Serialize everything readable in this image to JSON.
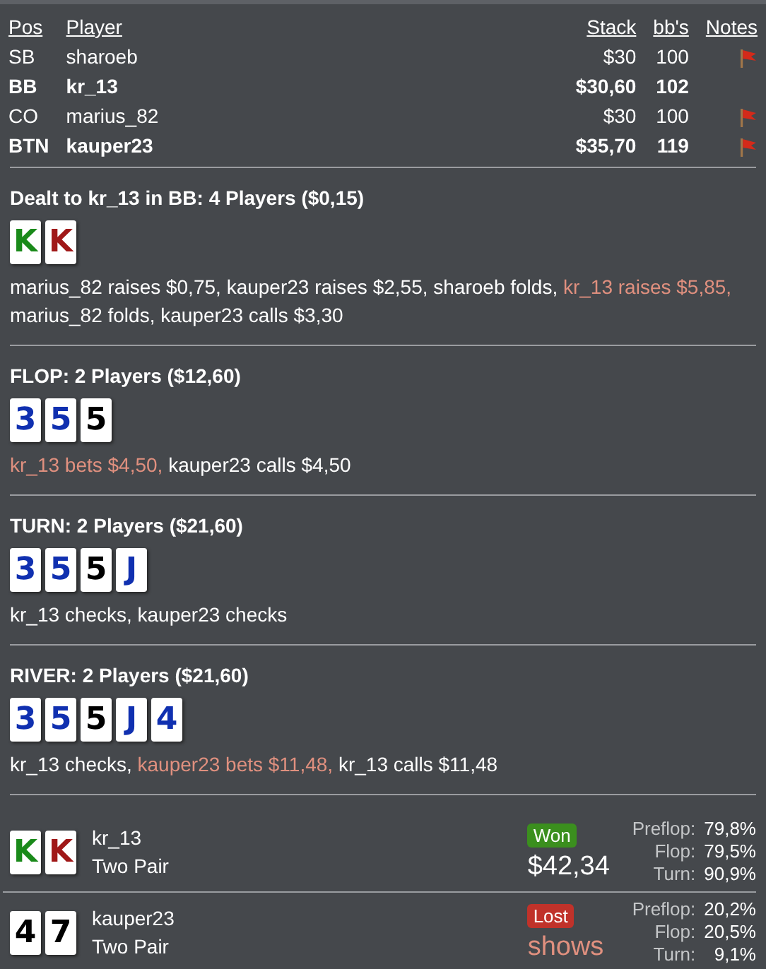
{
  "players": {
    "columns": [
      "Pos",
      "Player",
      "Stack",
      "bb's",
      "Notes"
    ],
    "rows": [
      {
        "pos": "SB",
        "name": "sharoeb",
        "stack": "$30",
        "bbs": "100",
        "bold": false,
        "note": true
      },
      {
        "pos": "BB",
        "name": "kr_13",
        "stack": "$30,60",
        "bbs": "102",
        "bold": true,
        "note": false
      },
      {
        "pos": "CO",
        "name": "marius_82",
        "stack": "$30",
        "bbs": "100",
        "bold": false,
        "note": true
      },
      {
        "pos": "BTN",
        "name": "kauper23",
        "stack": "$35,70",
        "bbs": "119",
        "bold": true,
        "note": true
      }
    ]
  },
  "streets": [
    {
      "title": "Dealt to kr_13 in BB: 4 Players ($0,15)",
      "cards": [
        {
          "rank": "K",
          "color": "#1a8a1a"
        },
        {
          "rank": "K",
          "color": "#a01818"
        }
      ],
      "actions": [
        {
          "text": "marius_82 raises $0,75, ",
          "hero": false
        },
        {
          "text": "kauper23 raises $2,55, ",
          "hero": false
        },
        {
          "text": "sharoeb folds, ",
          "hero": false
        },
        {
          "text": "kr_13 raises $5,85, ",
          "hero": true
        },
        {
          "text": "marius_82 folds, ",
          "hero": false
        },
        {
          "text": "kauper23 calls $3,30",
          "hero": false
        }
      ]
    },
    {
      "title": "FLOP: 2 Players ($12,60)",
      "cards": [
        {
          "rank": "3",
          "color": "#1030b0"
        },
        {
          "rank": "5",
          "color": "#1030b0"
        },
        {
          "rank": "5",
          "color": "#000000"
        }
      ],
      "actions": [
        {
          "text": "kr_13 bets $4,50, ",
          "hero": true
        },
        {
          "text": "kauper23 calls $4,50",
          "hero": false
        }
      ]
    },
    {
      "title": "TURN: 2 Players ($21,60)",
      "cards": [
        {
          "rank": "3",
          "color": "#1030b0"
        },
        {
          "rank": "5",
          "color": "#1030b0"
        },
        {
          "rank": "5",
          "color": "#000000"
        },
        {
          "rank": "J",
          "color": "#1030b0"
        }
      ],
      "actions": [
        {
          "text": "kr_13 checks, ",
          "hero": false
        },
        {
          "text": "kauper23 checks",
          "hero": false
        }
      ]
    },
    {
      "title": "RIVER: 2 Players ($21,60)",
      "cards": [
        {
          "rank": "3",
          "color": "#1030b0"
        },
        {
          "rank": "5",
          "color": "#1030b0"
        },
        {
          "rank": "5",
          "color": "#000000"
        },
        {
          "rank": "J",
          "color": "#1030b0"
        },
        {
          "rank": "4",
          "color": "#1030b0"
        }
      ],
      "actions": [
        {
          "text": "kr_13 checks, ",
          "hero": false
        },
        {
          "text": "kauper23 bets $11,48, ",
          "hero": true
        },
        {
          "text": "kr_13 calls $11,48",
          "hero": false
        }
      ]
    }
  ],
  "results": [
    {
      "cards": [
        {
          "rank": "K",
          "color": "#1a8a1a"
        },
        {
          "rank": "K",
          "color": "#a01818"
        }
      ],
      "name": "kr_13",
      "hand": "Two Pair",
      "kind": "won",
      "badge": "Won",
      "amount": "$42,34",
      "equity": [
        {
          "label": "Preflop:",
          "value": "79,8%"
        },
        {
          "label": "Flop:",
          "value": "79,5%"
        },
        {
          "label": "Turn:",
          "value": "90,9%"
        }
      ]
    },
    {
      "cards": [
        {
          "rank": "4",
          "color": "#000000"
        },
        {
          "rank": "7",
          "color": "#000000"
        }
      ],
      "name": "kauper23",
      "hand": "Two Pair",
      "kind": "lost",
      "badge": "Lost",
      "amount": "shows",
      "equity": [
        {
          "label": "Preflop:",
          "value": "20,2%"
        },
        {
          "label": "Flop:",
          "value": "20,5%"
        },
        {
          "label": "Turn:",
          "value": "9,1%"
        }
      ]
    }
  ]
}
